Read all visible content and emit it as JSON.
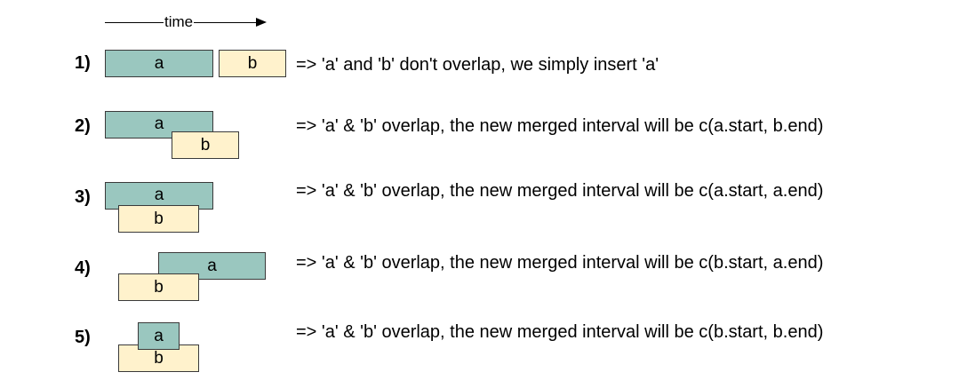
{
  "time_axis": {
    "label": "time"
  },
  "cases": [
    {
      "number": "1)",
      "a_label": "a",
      "b_label": "b",
      "description": "=> 'a' and 'b' don't overlap, we simply insert 'a'"
    },
    {
      "number": "2)",
      "a_label": "a",
      "b_label": "b",
      "description": "=> 'a' & 'b' overlap, the new merged interval will be c(a.start, b.end)"
    },
    {
      "number": "3)",
      "a_label": "a",
      "b_label": "b",
      "description": "=> 'a' & 'b' overlap, the new merged interval will be c(a.start, a.end)"
    },
    {
      "number": "4)",
      "a_label": "a",
      "b_label": "b",
      "description": "=> 'a' & 'b' overlap, the new merged interval will be c(b.start, a.end)"
    },
    {
      "number": "5)",
      "a_label": "a",
      "b_label": "b",
      "description": "=> 'a' & 'b' overlap, the new merged interval will be c(b.start, b.end)"
    }
  ],
  "colors": {
    "interval_a_fill": "#9ac7bf",
    "interval_b_fill": "#fff2cc",
    "border": "#3a3a3a"
  }
}
